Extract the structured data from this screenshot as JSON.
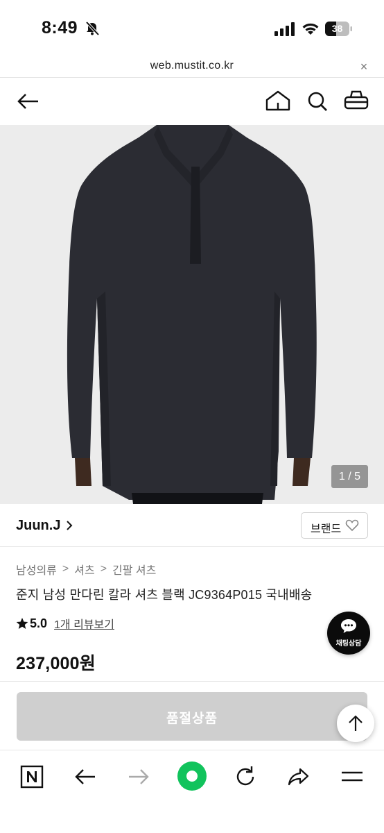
{
  "status_bar": {
    "time": "8:49",
    "battery": "38"
  },
  "url_bar": {
    "url": "web.mustit.co.kr",
    "close": "×"
  },
  "product": {
    "image_counter": "1 / 5",
    "brand": "Juun.J",
    "brand_button_label": "브랜드",
    "breadcrumb": [
      "남성의류",
      "셔츠",
      "긴팔 셔츠"
    ],
    "breadcrumb_separator": ">",
    "title": "준지 남성 만다린 칼라 셔츠 블랙 JC9364P015 국내배송",
    "rating": "5.0",
    "review_link": "1개 리뷰보기",
    "price": "237,000원"
  },
  "chat_button": {
    "label": "채팅상담"
  },
  "soldout_button": {
    "label": "품절상품"
  },
  "colors": {
    "accent_green": "#11c35c",
    "soldout_gray": "#cfcfcf"
  }
}
